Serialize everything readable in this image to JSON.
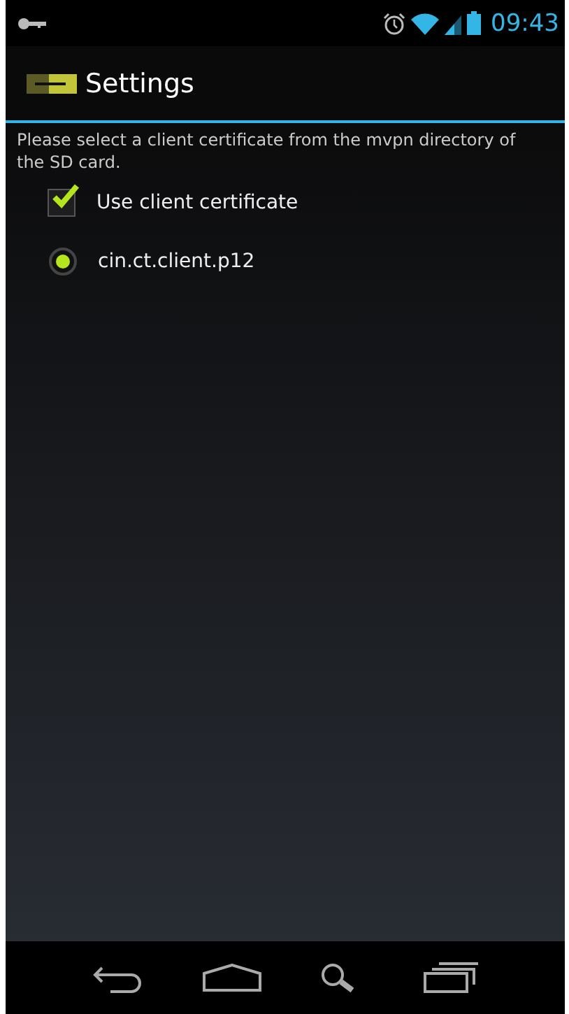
{
  "status_bar": {
    "time": "09:43"
  },
  "action_bar": {
    "title": "Settings"
  },
  "description": "Please select a client certificate from the mvpn directory of the SD card.",
  "options": [
    {
      "kind": "checkbox",
      "label": "Use client certificate",
      "checked": true
    },
    {
      "kind": "radio",
      "label": "cin.ct.client.p12",
      "selected": true
    }
  ]
}
